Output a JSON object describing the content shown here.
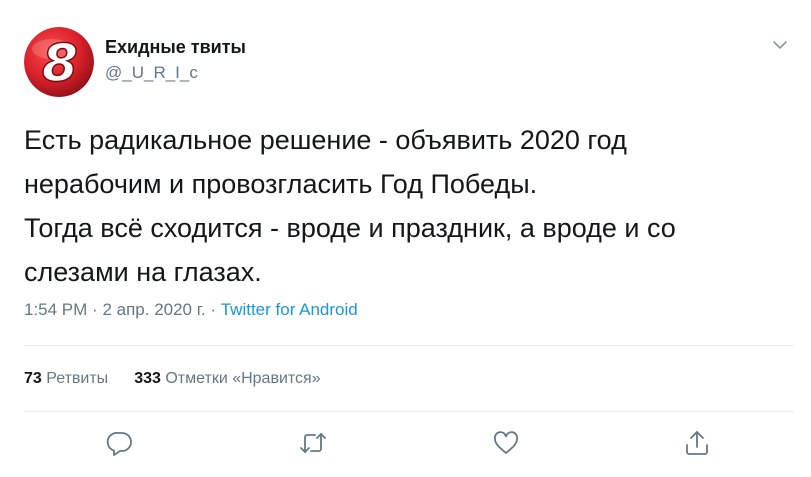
{
  "tweet": {
    "author": {
      "display_name": "Ехидные твиты",
      "handle": "@_U_R_I_c",
      "avatar_glyph": "8",
      "avatar_color": "#d7202a"
    },
    "text_lines": [
      "Есть радикальное решение - объявить 2020 год",
      "нерабочим и провозгласить Год Победы.",
      "Тогда всё сходится - вроде и праздник, а вроде и со",
      "слезами на глазах."
    ],
    "meta": {
      "time": "1:54 PM",
      "separator": "·",
      "date": "2 апр. 2020 г.",
      "source": "Twitter for Android"
    },
    "stats": {
      "retweets_count": "73",
      "retweets_label": "Ретвиты",
      "likes_count": "333",
      "likes_label": "Отметки «Нравится»"
    },
    "actions": [
      {
        "name": "reply",
        "icon": "reply-icon"
      },
      {
        "name": "retweet",
        "icon": "retweet-icon"
      },
      {
        "name": "like",
        "icon": "heart-icon"
      },
      {
        "name": "share",
        "icon": "share-icon"
      }
    ],
    "colors": {
      "text": "#14171a",
      "secondary": "#657786",
      "link": "#1b95e0",
      "divider": "#e6ecf0"
    }
  }
}
